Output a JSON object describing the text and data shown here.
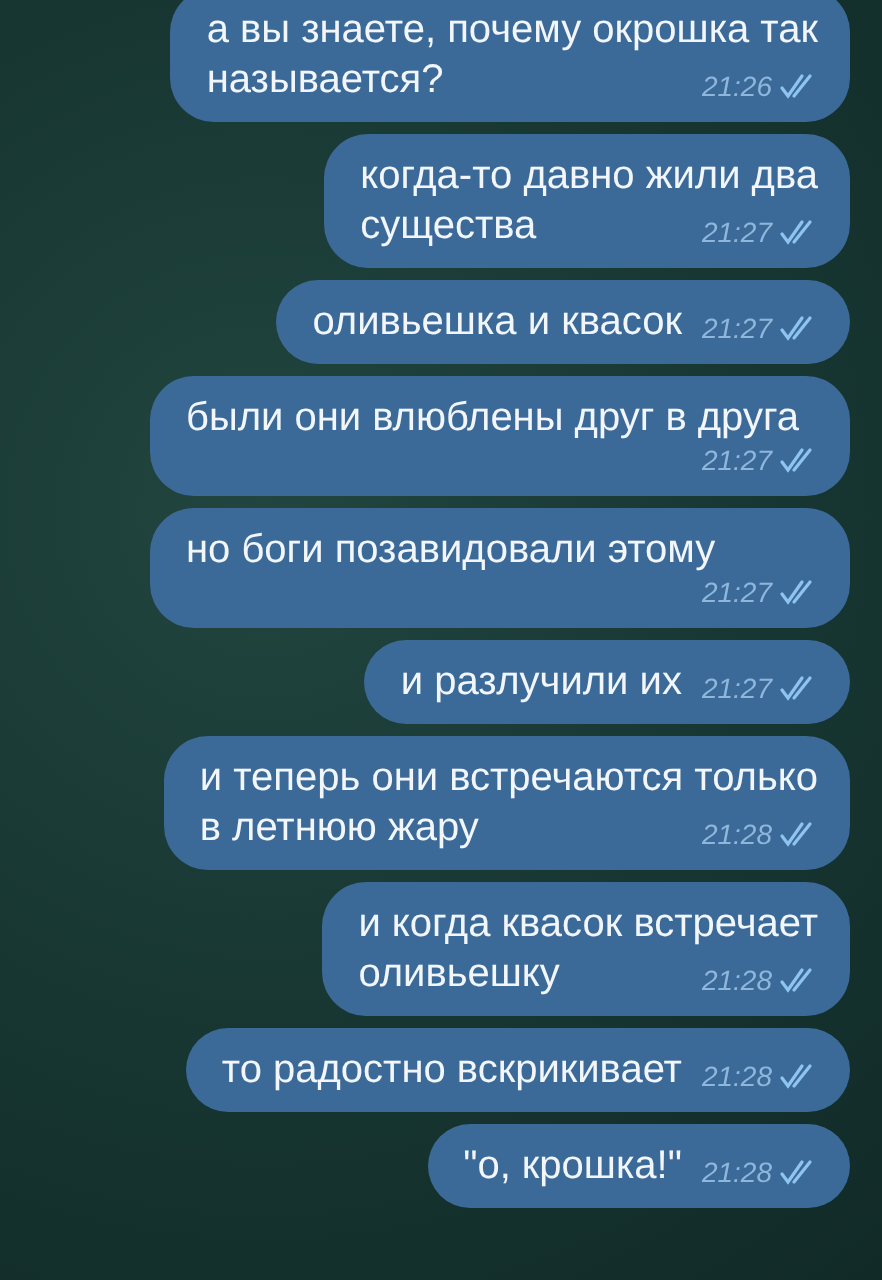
{
  "messages": [
    {
      "lines": [
        "а вы знаете, почему окрошка так",
        "называется?"
      ],
      "time": "21:26",
      "read": true
    },
    {
      "lines": [
        "когда-то давно жили два",
        "существа"
      ],
      "time": "21:27",
      "read": true
    },
    {
      "lines": [
        "оливьешка и квасок"
      ],
      "time": "21:27",
      "read": true
    },
    {
      "lines": [
        "были они влюблены друг в друга"
      ],
      "time": "21:27",
      "read": true
    },
    {
      "lines": [
        "но боги позавидовали этому"
      ],
      "time": "21:27",
      "read": true
    },
    {
      "lines": [
        "и разлучили их"
      ],
      "time": "21:27",
      "read": true
    },
    {
      "lines": [
        "и теперь они встречаются только",
        "в летнюю жару"
      ],
      "time": "21:28",
      "read": true
    },
    {
      "lines": [
        "и когда квасок встречает",
        "оливьешку"
      ],
      "time": "21:28",
      "read": true
    },
    {
      "lines": [
        "то радостно вскрикивает"
      ],
      "time": "21:28",
      "read": true
    },
    {
      "lines": [
        "\"о, крошка!\""
      ],
      "time": "21:28",
      "read": true
    }
  ]
}
